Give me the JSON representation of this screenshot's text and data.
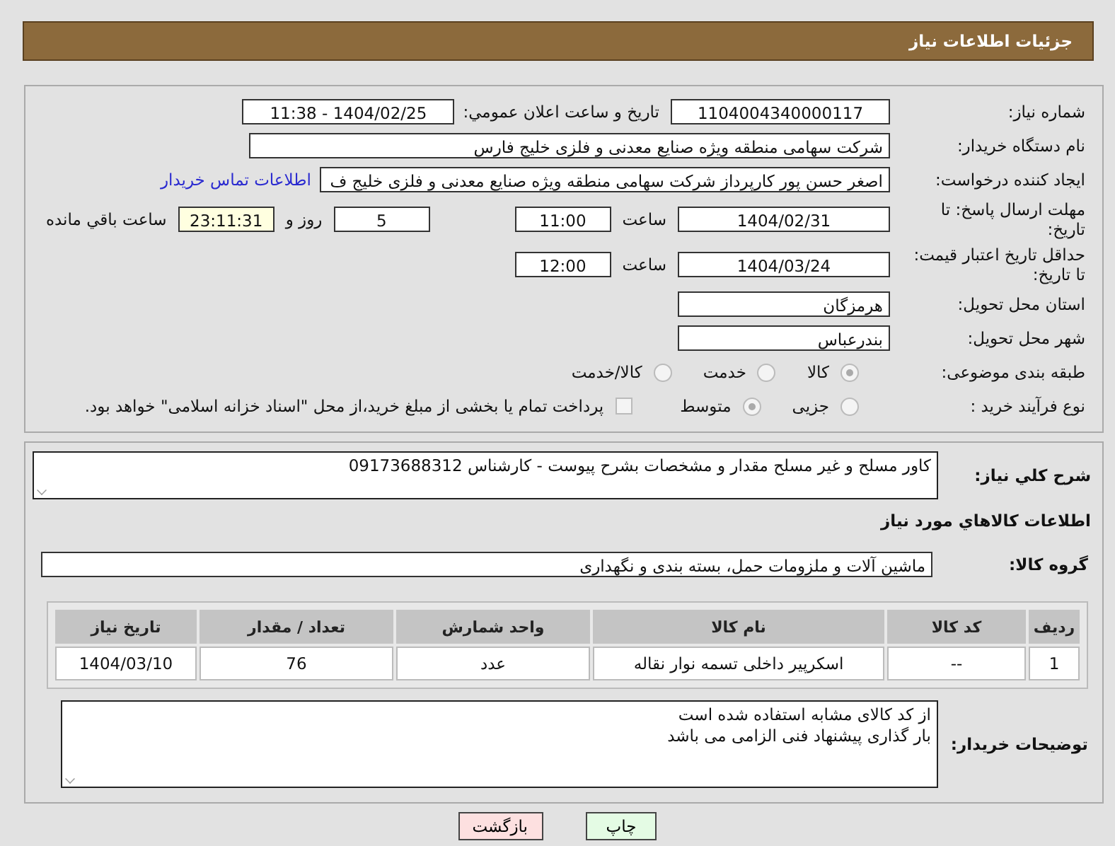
{
  "header": {
    "title": "جزئیات اطلاعات نیاز"
  },
  "need_number": {
    "label": "شماره نیاز:",
    "value": "1104004340000117"
  },
  "announce": {
    "label": "تاريخ و ساعت اعلان عمومي:",
    "value": "1404/02/25 - 11:38"
  },
  "buyer": {
    "label": "نام دستگاه خريدار:",
    "value": "شرکت سهامی منطقه ويژه صنايع معدنی و فلزی خليج فارس"
  },
  "creator": {
    "label": "ایجاد کننده درخواست:",
    "value": "اصغر حسن پور کارپرداز شرکت سهامی منطقه ويژه صنايع معدنی و فلزی خليج ف",
    "link": "اطلاعات تماس خريدار"
  },
  "deadline": {
    "label": "مهلت ارسال پاسخ: تا تاريخ:",
    "date": "1404/02/31",
    "time_label": "ساعت",
    "time": "11:00",
    "days": "5",
    "days_label": "روز و",
    "remaining": "23:11:31",
    "remaining_label": "ساعت باقي مانده"
  },
  "validity": {
    "label": "حداقل تاريخ اعتبار قيمت: تا تاريخ:",
    "date": "1404/03/24",
    "time_label": "ساعت",
    "time": "12:00"
  },
  "province": {
    "label": "استان محل تحويل:",
    "value": "هرمزگان"
  },
  "city": {
    "label": "شهر محل تحويل:",
    "value": "بندرعباس"
  },
  "category": {
    "label": "طبقه بندی موضوعی:",
    "options": [
      {
        "label": "کالا",
        "selected": true
      },
      {
        "label": "خدمت",
        "selected": false
      },
      {
        "label": "کالا/خدمت",
        "selected": false
      }
    ]
  },
  "process": {
    "label": "نوع فرآیند خرید :",
    "options": [
      {
        "label": "جزیی",
        "selected": false
      },
      {
        "label": "متوسط",
        "selected": true
      }
    ],
    "treasury": {
      "checked": false,
      "text": "پرداخت تمام يا بخشی از مبلغ خريد،از محل \"اسناد خزانه اسلامی\" خواهد بود."
    }
  },
  "description": {
    "label": "شرح کلي نياز:",
    "value": "کاور مسلح و غیر مسلح  مقدار و مشخصات بشرح پیوست - کارشناس 09173688312"
  },
  "goods_section": {
    "title": "اطلاعات کالاهاي مورد نياز"
  },
  "goods_group": {
    "label": "گروه کالا:",
    "value": "ماشین آلات و ملزومات حمل، بسته بندی و نگهداری"
  },
  "table": {
    "columns": [
      "ردیف",
      "کد کالا",
      "نام کالا",
      "واحد شمارش",
      "تعداد / مقدار",
      "تاریخ نیاز"
    ],
    "rows": [
      [
        "1",
        "--",
        "اسکرپیر داخلی تسمه نوار نقاله",
        "عدد",
        "76",
        "1404/03/10"
      ]
    ]
  },
  "buyer_notes": {
    "label": "توضیحات خریدار:",
    "lines": [
      "از کد کالای مشابه استفاده شده است",
      "بار گذاری پیشنهاد فنی الزامی می باشد"
    ]
  },
  "buttons": [
    {
      "label": "چاپ",
      "kind": "print"
    },
    {
      "label": "بازگشت",
      "kind": "back"
    }
  ]
}
